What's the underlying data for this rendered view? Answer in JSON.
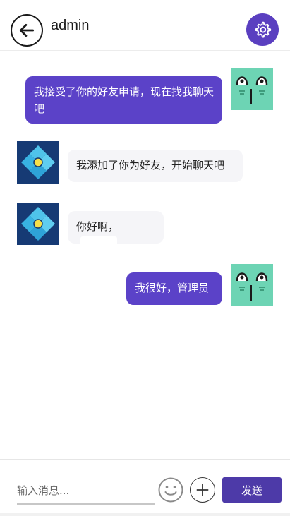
{
  "header": {
    "title": "admin"
  },
  "messages": [
    {
      "direction": "out",
      "text": "我接受了你的好友申请，现在找我聊天吧",
      "avatar": "green-face-sticker"
    },
    {
      "direction": "in",
      "text": "我添加了你为好友，开始聊天吧",
      "avatar": "blue-diamond-logo"
    },
    {
      "direction": "in",
      "text": "你好啊，",
      "avatar": "blue-diamond-logo"
    },
    {
      "direction": "out",
      "text": "我很好，管理员",
      "avatar": "green-face-sticker"
    }
  ],
  "composer": {
    "placeholder": "输入消息...",
    "send_label": "发送"
  },
  "icons": {
    "back": "arrow-left-icon",
    "settings": "gear-icon",
    "emoji": "smiley-icon",
    "add": "plus-icon"
  },
  "colors": {
    "accent": "#5b42c8",
    "send_button": "#4d3aa8",
    "sticker_bg": "#6dd4b4",
    "logo_bg": "#163a74"
  }
}
